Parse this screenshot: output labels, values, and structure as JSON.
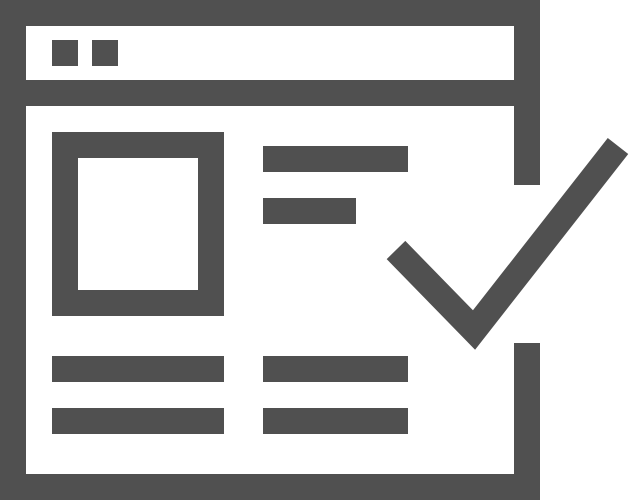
{
  "icon": {
    "name": "webpage-approved-icon",
    "stroke_color": "#505050",
    "background_color": "#ffffff",
    "has_checkmark": true
  }
}
